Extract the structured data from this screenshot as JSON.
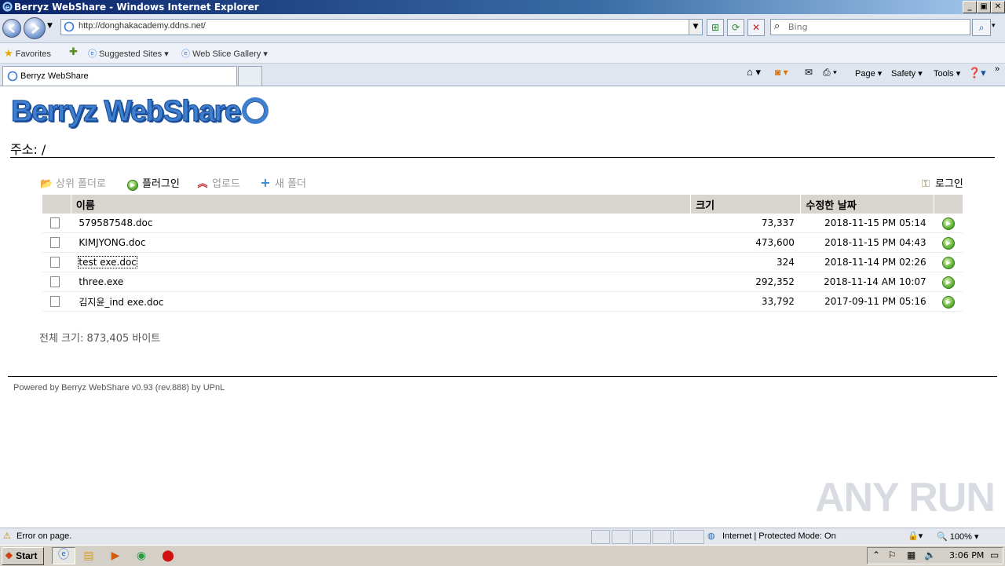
{
  "window": {
    "title": "Berryz WebShare - Windows Internet Explorer"
  },
  "browser": {
    "address": "http://donghakacademy.ddns.net/",
    "search_placeholder": "Bing",
    "favorites_label": "Favorites",
    "suggested_sites": "Suggested Sites",
    "web_slice_gallery": "Web Slice Gallery",
    "tab_title": "Berryz WebShare",
    "commands": {
      "page": "Page",
      "safety": "Safety",
      "tools": "Tools"
    }
  },
  "page": {
    "logo_text": "Berryz WebShare",
    "path_label": "주소: /",
    "toolbar": {
      "parent_folder": "상위 폴더로",
      "plugin": "플러그인",
      "upload": "업로드",
      "new_folder": "새 폴더",
      "login": "로그인"
    },
    "table": {
      "headers": {
        "name": "이름",
        "size": "크기",
        "modified": "수정한 날짜"
      },
      "rows": [
        {
          "name": "579587548.doc",
          "size": "73,337",
          "modified": "2018-11-15 PM 05:14"
        },
        {
          "name": "KIMJYONG.doc",
          "size": "473,600",
          "modified": "2018-11-15 PM 04:43"
        },
        {
          "name": "test exe.doc",
          "size": "324",
          "modified": "2018-11-14 PM 02:26"
        },
        {
          "name": "three.exe",
          "size": "292,352",
          "modified": "2018-11-14 AM 10:07"
        },
        {
          "name": "김지윤_ind exe.doc",
          "size": "33,792",
          "modified": "2017-09-11 PM 05:16"
        }
      ]
    },
    "total": "전체 크기: 873,405 바이트",
    "footer": "Powered by Berryz WebShare v0.93 (rev.888) by UPnL"
  },
  "watermark": "ANY RUN",
  "status": {
    "error": "Error on page.",
    "zone": "Internet | Protected Mode: On",
    "zoom": "100%"
  },
  "taskbar": {
    "start": "Start",
    "clock": "3:06 PM"
  }
}
